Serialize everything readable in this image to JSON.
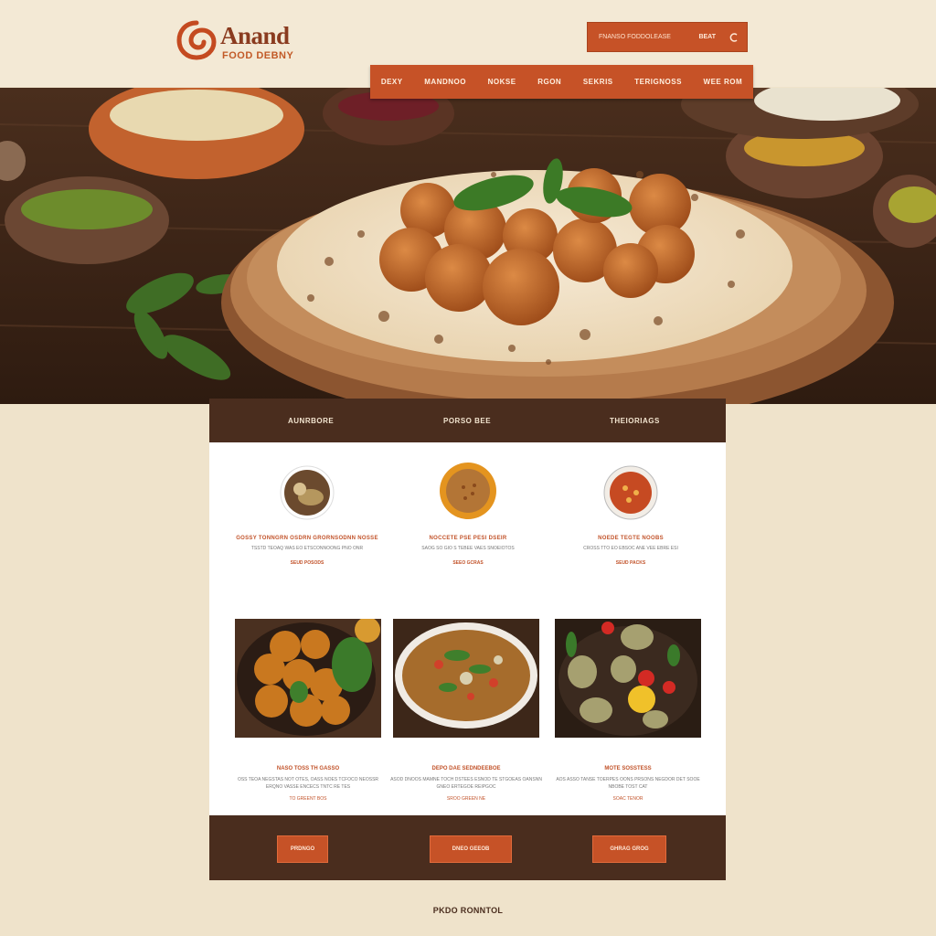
{
  "brand": {
    "name": "Anand",
    "tagline": "FOOD DEBNY"
  },
  "search": {
    "placeholder": "FNANSO FODDOLEASE",
    "button_label": "BEAT",
    "icon": "search-icon"
  },
  "nav": {
    "items": [
      "DEXY",
      "MANDNOO",
      "NOKSE",
      "RGON",
      "SEKRIS",
      "TERIGNOSS",
      "WEE ROM"
    ]
  },
  "panel_header": {
    "items": [
      "AUNRBORE",
      "PORSO BEE",
      "THEIORIAGS"
    ]
  },
  "features": [
    {
      "title": "GOSSY TONNGRN OSDRN GRORNSODNN NOSSE",
      "text": "TSSTD TEOAQ WAS EO ETSCONNOONG PNO ONR",
      "link": "SEUD POSODS"
    },
    {
      "title": "NOCCETE PSE PESI DSEIR",
      "text": "SAOG SO GIO S TEBEE VAES SNOEIOTOS",
      "link": "SEEO GCRAS"
    },
    {
      "title": "NOEDE TEGTE NOOBS",
      "text": "CROSS TTO EO EBSOC ANE VEE EBRE ESI",
      "link": "SEUD PACKS"
    }
  ],
  "dishes": [
    {
      "title": "NASO TOSS TH GASSO",
      "text": "OSS TEOA NEGSTAS NOT OTES, OASS NOES TCFOCO NEOSSR ERQNO VASSE ENCECS TNTC RE TES",
      "link": "TO GREENT BOS"
    },
    {
      "title": "DEPO DAE SEDNDEEBOE",
      "text": "ASOD DNOOS MAMNE TOCH DSTEES ESNOD TE STGOEAS OANSNN GNEO ERTEGOE REIPGOC",
      "link": "SROO GREEN NE"
    },
    {
      "title": "MOTE SOSSTESS",
      "text": "AOS ASSO TANSE TOERPES OONS PRSONS NEGDOR DET SOOE NBOBE TOST CAT",
      "link": "SOAC TENOR"
    }
  ],
  "footer_buttons": [
    "PRDNGO",
    "DNEO GEEOB",
    "GHRAG GROG"
  ],
  "footer": {
    "text": "PKDO RONNTOL"
  },
  "colors": {
    "accent": "#c65227",
    "dark": "#4a2d1e",
    "background": "#efe3cb"
  }
}
